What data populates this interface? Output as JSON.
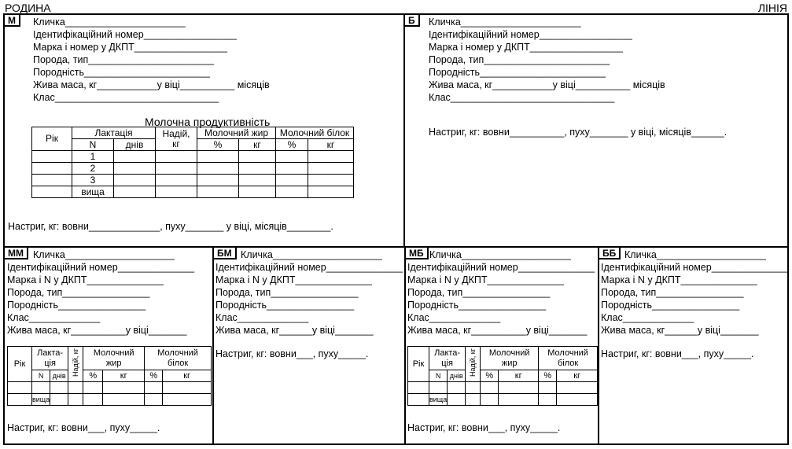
{
  "header": {
    "left": "РОДИНА",
    "right": "ЛІНІЯ"
  },
  "M": {
    "tag": "М",
    "lines": [
      "Кличка______________________",
      "Ідентифікаційний номер_________________",
      "Марка і номер у ДКПТ_________________",
      "Порода, тип_______________________",
      "Породність_______________________",
      "Жива маса, кг___________у віці__________ місяців",
      "Клас______________________________"
    ],
    "table_title": "Молочна продуктивність",
    "th": {
      "year": "Рік",
      "lact": "Лактація",
      "milk": "Надій,",
      "kg": "кг",
      "fat": "Молочний жир",
      "protein": "Молочний білок",
      "n": "N",
      "days": "днів",
      "pct": "%"
    },
    "rows": [
      "1",
      "2",
      "3",
      "вища"
    ],
    "shearing": "Настриг, кг: вовни_____________, пуху_______ у віці, місяців________."
  },
  "B": {
    "tag": "Б",
    "lines": [
      "Кличка______________________",
      "Ідентифікаційний номер_________________",
      "Марка і номер у ДКПТ_________________",
      "Порода, тип_______________________",
      "Породність_______________________",
      "Жива маса, кг___________у віці__________ місяців",
      "Клас______________________________"
    ],
    "shearing": "Настриг, кг: вовни__________, пуху_______ у віці, місяців______."
  },
  "MM": {
    "tag": "ММ",
    "lines": [
      "Кличка____________________",
      "Ідентифікаційний номер______________",
      "Марка і N у ДКПТ______________",
      "Порода, тип________________",
      "Породність________________",
      "Клас_____________",
      "Жива маса, кг__________у віці_______"
    ],
    "th": {
      "year": "Рік",
      "lact1": "Лакта-",
      "lact2": "ція",
      "milk": "Надій, кг",
      "fat1": "Молочний",
      "fat2": "жир",
      "prot1": "Молочний",
      "prot2": "білок",
      "n": "N",
      "days": "днів",
      "pct": "%",
      "kg": "кг"
    },
    "last_row": "вища",
    "shearing": "Настриг, кг: вовни___, пуху_____."
  },
  "BM": {
    "tag": "БМ",
    "lines": [
      "Кличка____________________",
      "Ідентифікаційний номер______________",
      "Марка і N у ДКПТ______________",
      "Порода, тип________________",
      "Породність________________",
      "Клас_____________",
      "Жива маса, кг______у віці_______"
    ],
    "shearing": "Настриг, кг: вовни___, пуху_____."
  },
  "MB": {
    "tag": "МБ",
    "lines": [
      "Кличка____________________",
      "Ідентифікаційний номер______________",
      "Марка і N у ДКПТ______________",
      "Порода, тип________________",
      "Породність________________",
      "Клас_____________",
      "Жива маса, кг__________у віці_______"
    ],
    "th": {
      "year": "Рік",
      "lact1": "Лакта-",
      "lact2": "ція",
      "milk": "Надій, кг",
      "fat1": "Молочний",
      "fat2": "жир",
      "prot1": "Молочний",
      "prot2": "білок",
      "n": "N",
      "days": "днів",
      "pct": "%",
      "kg": "кг"
    },
    "last_row": "вища",
    "shearing": "Настриг, кг: вовни___, пуху_____."
  },
  "BB": {
    "tag": "ББ",
    "lines": [
      "Кличка____________________",
      "Ідентифікаційний номер______________",
      "Марка і N у ДКПТ______________",
      "Порода, тип________________",
      "Породність________________",
      "Клас_____________",
      "Жива маса, кг______у віці_______"
    ],
    "shearing": "Настриг, кг: вовни___, пуху_____."
  }
}
